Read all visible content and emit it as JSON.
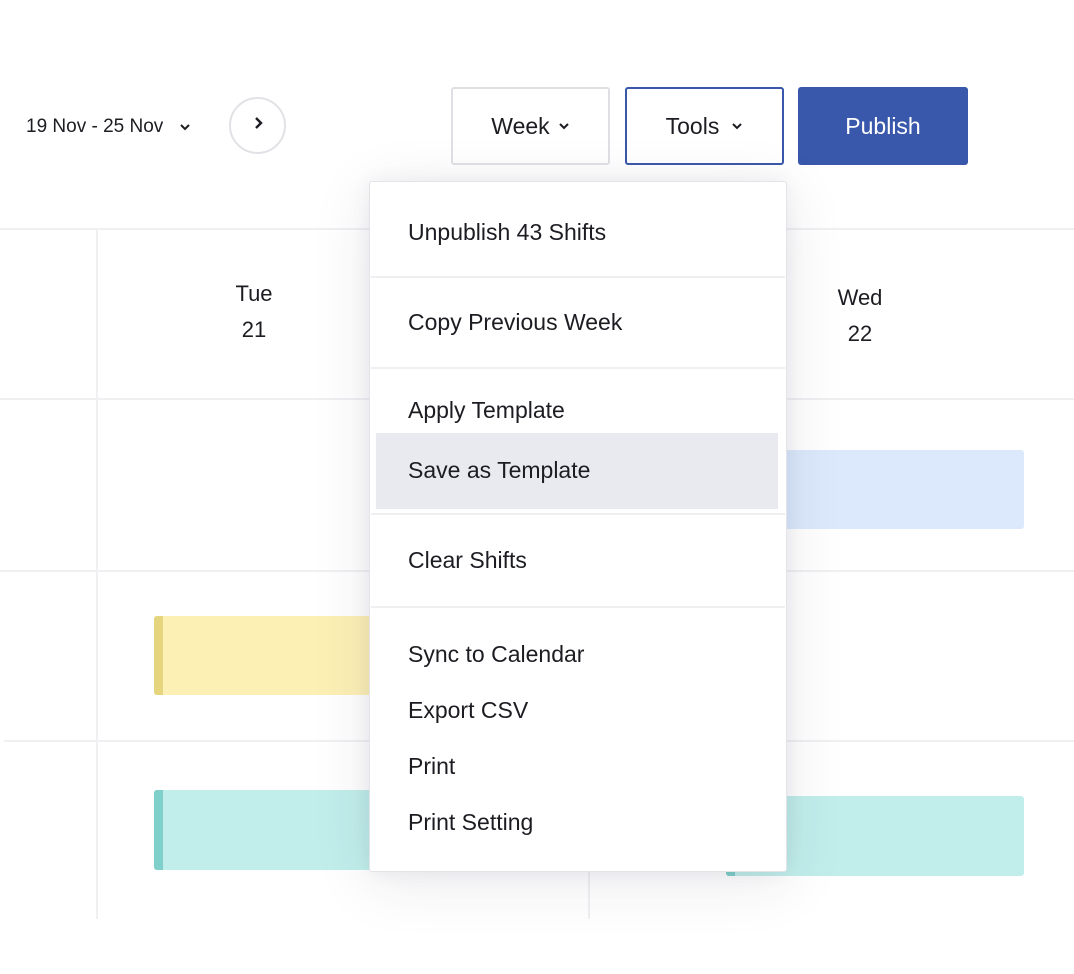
{
  "toolbar": {
    "date_range": "19 Nov - 25 Nov",
    "date_range_icon": "chevron-down-icon",
    "next_icon": "chevron-right-icon",
    "view_label": "Week",
    "tools_label": "Tools",
    "publish_label": "Publish"
  },
  "colors": {
    "accent": "#3a58ab",
    "shift_yellow": "#fdf0b5",
    "shift_yellow_accent": "#e6d57f",
    "shift_teal": "#c1eeeb",
    "shift_teal_accent": "#7fcfca",
    "shift_blue": "#dce9fc",
    "menu_highlight": "#e9eaef"
  },
  "calendar": {
    "days": [
      {
        "name": "Tue",
        "date": "21"
      },
      {
        "name": "Wed",
        "date": "22"
      }
    ]
  },
  "tools_menu": {
    "groups": [
      [
        "Unpublish 43 Shifts"
      ],
      [
        "Copy Previous Week"
      ],
      [
        "Apply Template",
        "Save as Template"
      ],
      [
        "Clear Shifts"
      ],
      [
        "Sync to Calendar",
        "Export CSV",
        "Print",
        "Print Setting"
      ]
    ],
    "highlighted": "Save as Template"
  }
}
